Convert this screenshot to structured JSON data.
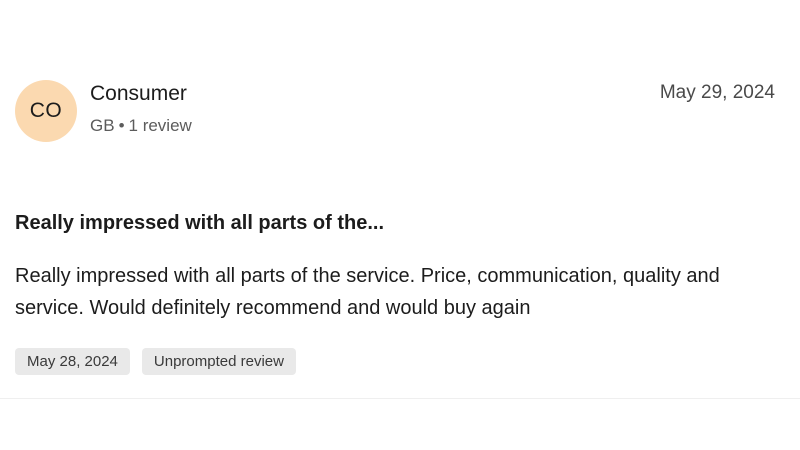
{
  "review": {
    "avatar_initials": "CO",
    "reviewer_name": "Consumer",
    "country": "GB",
    "separator": "•",
    "review_count": "1 review",
    "date_posted": "May 29, 2024",
    "title": "Really impressed with all parts of the...",
    "body": "Really impressed with all parts of the service. Price, communication, quality and service. Would definitely recommend and would buy again",
    "tags": {
      "experience_date": "May 28, 2024",
      "review_type": "Unprompted review"
    }
  },
  "colors": {
    "avatar_background": "#fbd9b0",
    "tag_background": "#e9e9e9"
  }
}
